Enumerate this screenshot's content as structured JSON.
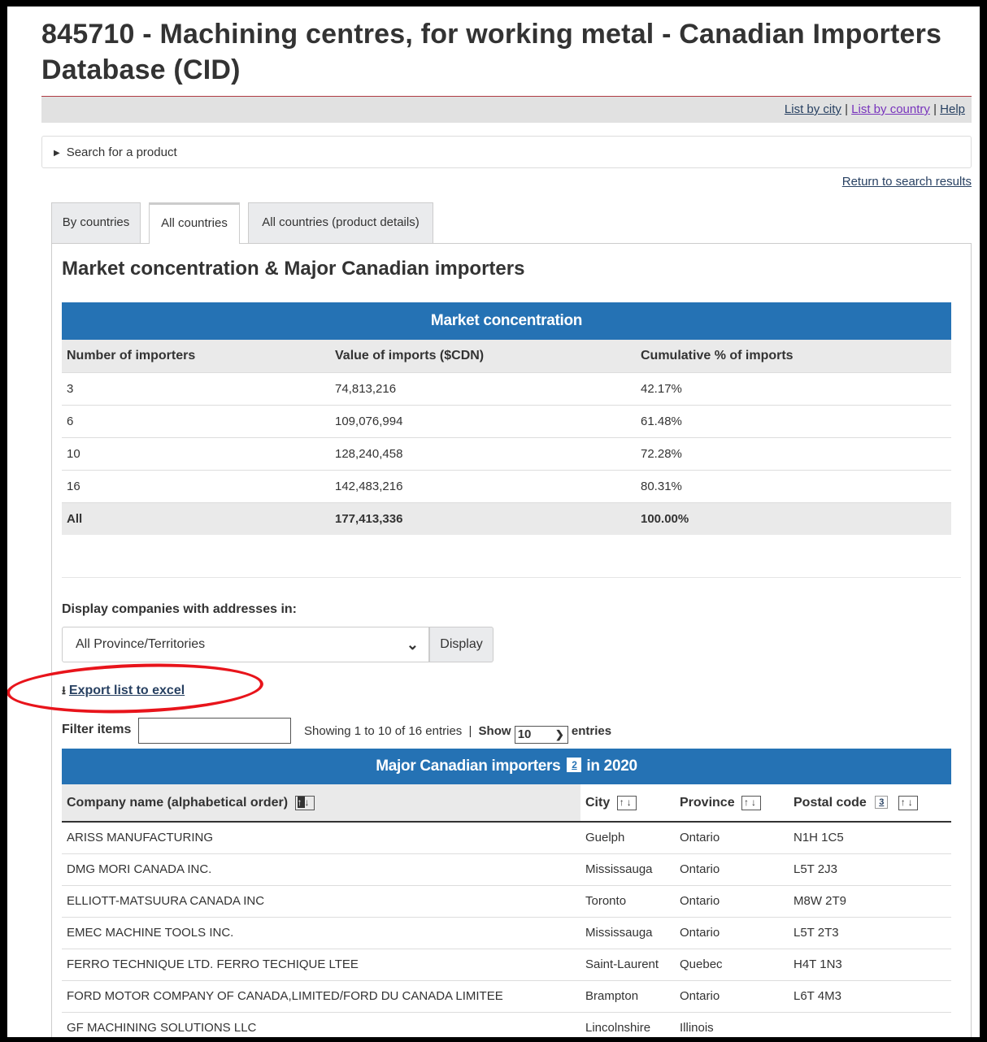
{
  "page": {
    "title": "845710 - Machining centres, for working metal - Canadian Importers Database (CID)"
  },
  "linkbar": {
    "list_by_city": "List by city",
    "sep1": "|",
    "list_by_country": "List by country",
    "sep2": "|",
    "help": "Help"
  },
  "search": {
    "label": "Search for a product"
  },
  "return_link": "Return to search results",
  "tabs": [
    {
      "label": "By countries",
      "active": false
    },
    {
      "label": "All countries",
      "active": true
    },
    {
      "label": "All countries (product details)",
      "active": false
    }
  ],
  "section_title": "Market concentration & Major Canadian importers",
  "market_concentration": {
    "caption": "Market concentration",
    "headers": [
      "Number of importers",
      "Value of imports ($CDN)",
      "Cumulative % of imports"
    ],
    "rows": [
      [
        "3",
        "74,813,216",
        "42.17%"
      ],
      [
        "6",
        "109,076,994",
        "61.48%"
      ],
      [
        "10",
        "128,240,458",
        "72.28%"
      ],
      [
        "16",
        "142,483,216",
        "80.31%"
      ]
    ],
    "total": [
      "All",
      "177,413,336",
      "100.00%"
    ]
  },
  "display_filter": {
    "label": "Display companies with addresses in:",
    "selected": "All Province/Territories",
    "button": "Display"
  },
  "export": {
    "label": "Export list to excel"
  },
  "filter": {
    "label": "Filter items",
    "value": "",
    "showing": "Showing 1 to 10 of 16 entries",
    "show_label": "Show",
    "show_value": "10",
    "entries_label": "entries"
  },
  "importers": {
    "caption_prefix": "Major Canadian importers",
    "footnote_caption": "2",
    "caption_suffix": "in 2020",
    "headers": {
      "company": "Company name (alphabetical order)",
      "city": "City",
      "province": "Province",
      "postal": "Postal code",
      "postal_footnote": "3"
    },
    "rows": [
      [
        "ARISS MANUFACTURING",
        "Guelph",
        "Ontario",
        "N1H 1C5"
      ],
      [
        "DMG MORI CANADA INC.",
        "Mississauga",
        "Ontario",
        "L5T 2J3"
      ],
      [
        "ELLIOTT-MATSUURA CANADA INC",
        "Toronto",
        "Ontario",
        "M8W 2T9"
      ],
      [
        "EMEC MACHINE TOOLS INC.",
        "Mississauga",
        "Ontario",
        "L5T 2T3"
      ],
      [
        "FERRO TECHNIQUE LTD. FERRO TECHIQUE LTEE",
        "Saint-Laurent",
        "Quebec",
        "H4T 1N3"
      ],
      [
        "FORD MOTOR COMPANY OF CANADA,LIMITED/FORD DU CANADA LIMITEE",
        "Brampton",
        "Ontario",
        "L6T 4M3"
      ],
      [
        "GF MACHINING SOLUTIONS LLC",
        "Lincolnshire",
        "Illinois",
        ""
      ]
    ]
  },
  "colors": {
    "header_blue": "#2572b4",
    "title_rule": "#af3c43",
    "highlight_ellipse": "#e8141b"
  }
}
